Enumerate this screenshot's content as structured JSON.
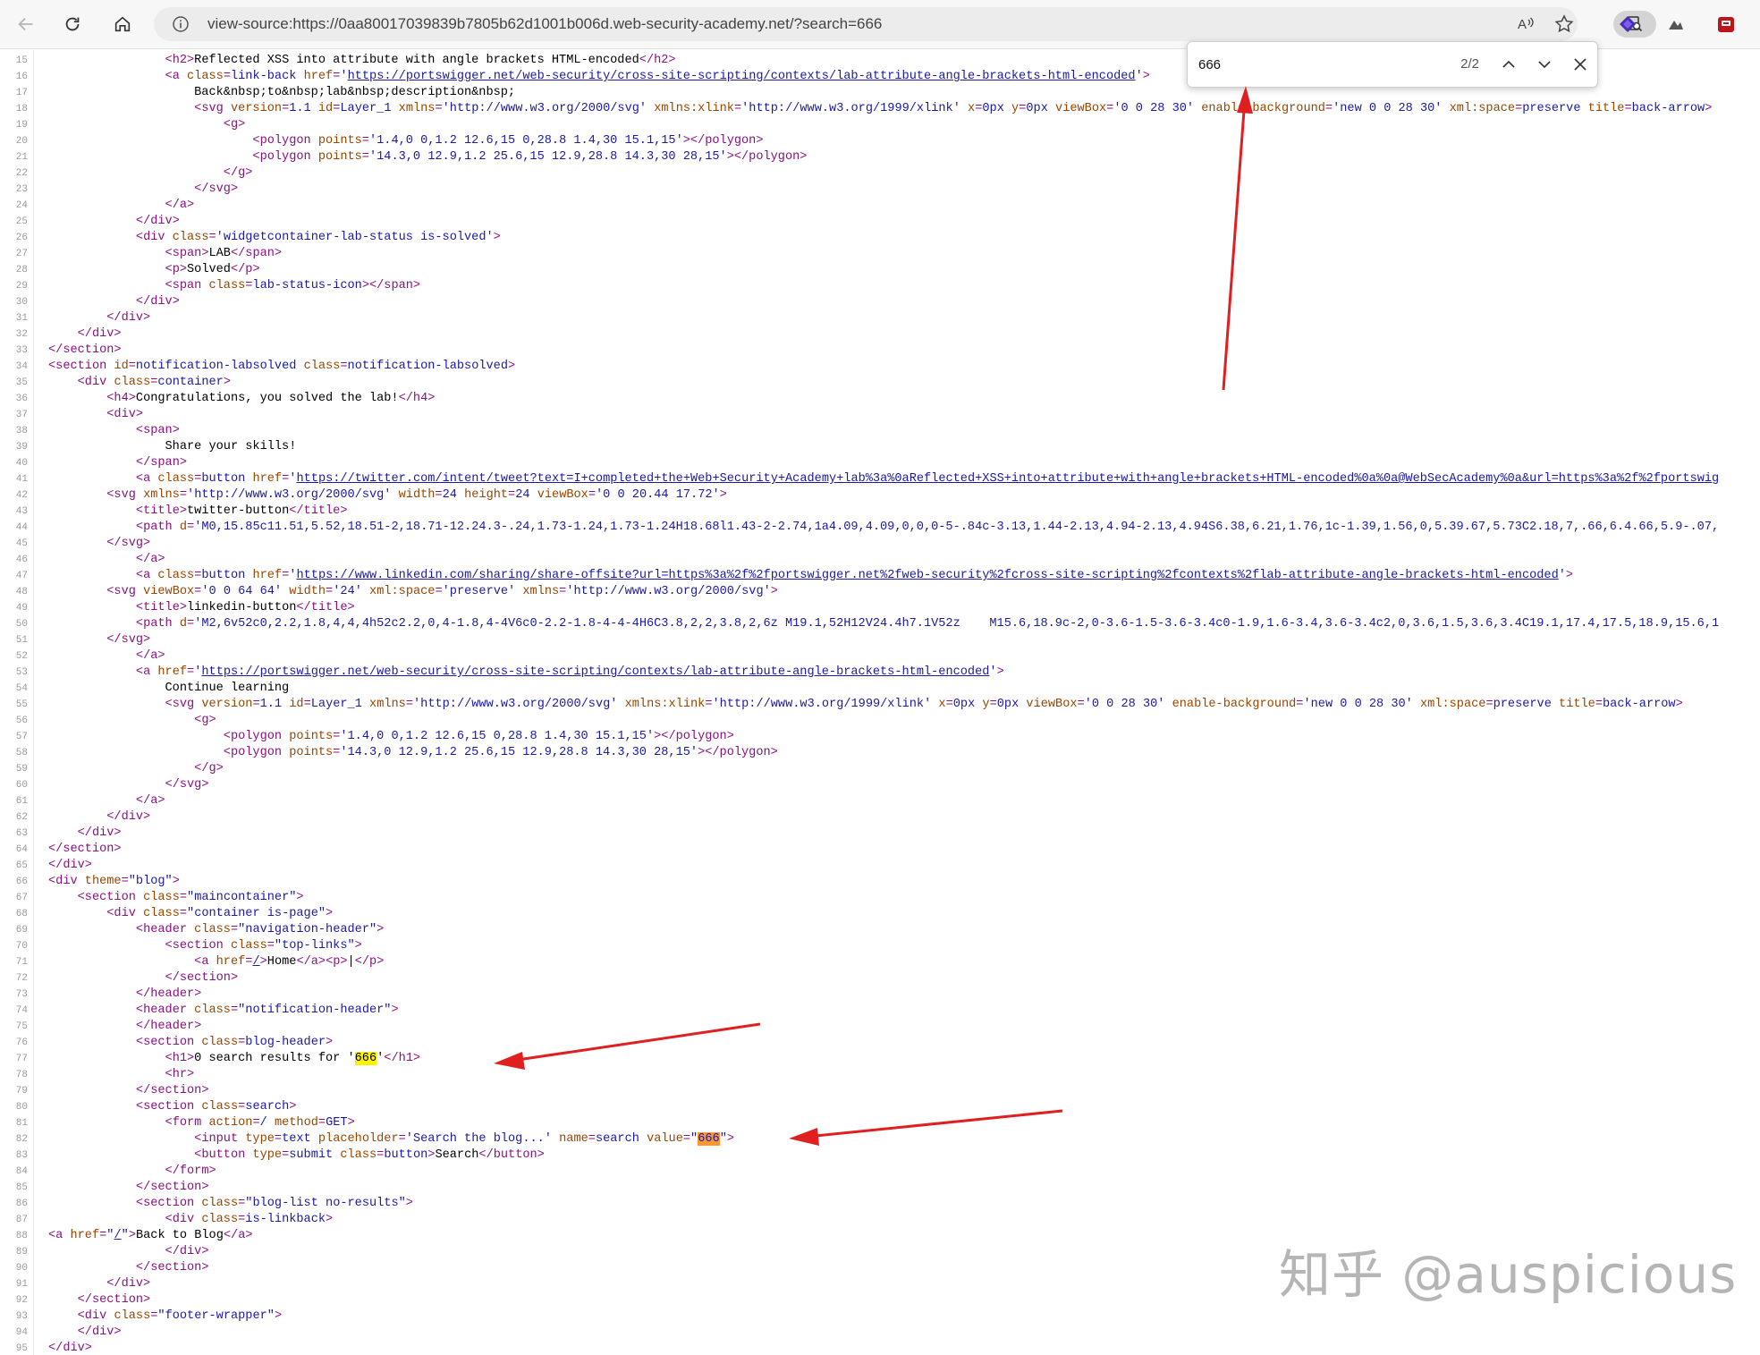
{
  "browser": {
    "url": "view-source:https://0aa80017039839b7805b62d1001b006d.web-security-academy.net/?search=666"
  },
  "find_bar": {
    "query": "666",
    "match_count": "2/2"
  },
  "source_lines": [
    {
      "n": "15",
      "html": "                <span class=\"t\">&lt;h2&gt;</span>Reflected XSS into attribute with angle brackets HTML-encoded<span class=\"t\">&lt;/h2&gt;</span>"
    },
    {
      "n": "16",
      "html": "                <span class=\"t\">&lt;a </span><span class=\"a\">class</span><span class=\"t\">=</span><span class=\"v\">link-back</span> <span class=\"a\">href</span><span class=\"t\">=</span><span class=\"v\">'</span><span class=\"l\">https://portswigger.net/web-security/cross-site-scripting/contexts/lab-attribute-angle-brackets-html-encoded</span><span class=\"v\">'</span><span class=\"t\">&gt;</span>"
    },
    {
      "n": "17",
      "html": "                    Back&amp;nbsp;to&amp;nbsp;lab&amp;nbsp;description&amp;nbsp;"
    },
    {
      "n": "18",
      "html": "                    <span class=\"t\">&lt;svg </span><span class=\"a\">version</span><span class=\"t\">=</span><span class=\"v\">1.1</span> <span class=\"a\">id</span><span class=\"t\">=</span><span class=\"v\">Layer_1</span> <span class=\"a\">xmlns</span><span class=\"t\">=</span><span class=\"v\">'http://www.w3.org/2000/svg'</span> <span class=\"a\">xmlns:xlink</span><span class=\"t\">=</span><span class=\"v\">'http://www.w3.org/1999/xlink'</span> <span class=\"a\">x</span><span class=\"t\">=</span><span class=\"v\">0px</span> <span class=\"a\">y</span><span class=\"t\">=</span><span class=\"v\">0px</span> <span class=\"a\">viewBox</span><span class=\"t\">=</span><span class=\"v\">'0 0 28 30'</span> <span class=\"a\">enable-background</span><span class=\"t\">=</span><span class=\"v\">'new 0 0 28 30'</span> <span class=\"a\">xml:space</span><span class=\"t\">=</span><span class=\"v\">preserve</span> <span class=\"a\">title</span><span class=\"t\">=</span><span class=\"v\">back-arrow</span><span class=\"t\">&gt;</span>"
    },
    {
      "n": "19",
      "html": "                        <span class=\"t\">&lt;g&gt;</span>"
    },
    {
      "n": "20",
      "html": "                            <span class=\"t\">&lt;polygon </span><span class=\"a\">points</span><span class=\"t\">=</span><span class=\"v\">'1.4,0 0,1.2 12.6,15 0,28.8 1.4,30 15.1,15'</span><span class=\"t\">&gt;&lt;/polygon&gt;</span>"
    },
    {
      "n": "21",
      "html": "                            <span class=\"t\">&lt;polygon </span><span class=\"a\">points</span><span class=\"t\">=</span><span class=\"v\">'14.3,0 12.9,1.2 25.6,15 12.9,28.8 14.3,30 28,15'</span><span class=\"t\">&gt;&lt;/polygon&gt;</span>"
    },
    {
      "n": "22",
      "html": "                        <span class=\"t\">&lt;/g&gt;</span>"
    },
    {
      "n": "23",
      "html": "                    <span class=\"t\">&lt;/svg&gt;</span>"
    },
    {
      "n": "24",
      "html": "                <span class=\"t\">&lt;/a&gt;</span>"
    },
    {
      "n": "25",
      "html": "            <span class=\"t\">&lt;/div&gt;</span>"
    },
    {
      "n": "26",
      "html": "            <span class=\"t\">&lt;div </span><span class=\"a\">class</span><span class=\"t\">=</span><span class=\"v\">'widgetcontainer-lab-status is-solved'</span><span class=\"t\">&gt;</span>"
    },
    {
      "n": "27",
      "html": "                <span class=\"t\">&lt;span&gt;</span>LAB<span class=\"t\">&lt;/span&gt;</span>"
    },
    {
      "n": "28",
      "html": "                <span class=\"t\">&lt;p&gt;</span>Solved<span class=\"t\">&lt;/p&gt;</span>"
    },
    {
      "n": "29",
      "html": "                <span class=\"t\">&lt;span </span><span class=\"a\">class</span><span class=\"t\">=</span><span class=\"v\">lab-status-icon</span><span class=\"t\">&gt;&lt;/span&gt;</span>"
    },
    {
      "n": "30",
      "html": "            <span class=\"t\">&lt;/div&gt;</span>"
    },
    {
      "n": "31",
      "html": "        <span class=\"t\">&lt;/div&gt;</span>"
    },
    {
      "n": "32",
      "html": "    <span class=\"t\">&lt;/div&gt;</span>"
    },
    {
      "n": "33",
      "html": "<span class=\"t\">&lt;/section&gt;</span>"
    },
    {
      "n": "34",
      "html": "<span class=\"t\">&lt;section </span><span class=\"a\">id</span><span class=\"t\">=</span><span class=\"v\">notification-labsolved</span> <span class=\"a\">class</span><span class=\"t\">=</span><span class=\"v\">notification-labsolved</span><span class=\"t\">&gt;</span>"
    },
    {
      "n": "35",
      "html": "    <span class=\"t\">&lt;div </span><span class=\"a\">class</span><span class=\"t\">=</span><span class=\"v\">container</span><span class=\"t\">&gt;</span>"
    },
    {
      "n": "36",
      "html": "        <span class=\"t\">&lt;h4&gt;</span>Congratulations, you solved the lab!<span class=\"t\">&lt;/h4&gt;</span>"
    },
    {
      "n": "37",
      "html": "        <span class=\"t\">&lt;div&gt;</span>"
    },
    {
      "n": "38",
      "html": "            <span class=\"t\">&lt;span&gt;</span>"
    },
    {
      "n": "39",
      "html": "                Share your skills!"
    },
    {
      "n": "40",
      "html": "            <span class=\"t\">&lt;/span&gt;</span>"
    },
    {
      "n": "41",
      "html": "            <span class=\"t\">&lt;a </span><span class=\"a\">class</span><span class=\"t\">=</span><span class=\"v\">button</span> <span class=\"a\">href</span><span class=\"t\">=</span><span class=\"v\">'</span><span class=\"l\">https://twitter.com/intent/tweet?text=I+completed+the+Web+Security+Academy+lab%3a%0aReflected+XSS+into+attribute+with+angle+brackets+HTML-encoded%0a%0a@WebSecAcademy%0a&amp;url=https%3a%2f%2fportswig</span>"
    },
    {
      "n": "42",
      "html": "        <span class=\"t\">&lt;svg </span><span class=\"a\">xmlns</span><span class=\"t\">=</span><span class=\"v\">'http://www.w3.org/2000/svg'</span> <span class=\"a\">width</span><span class=\"t\">=</span><span class=\"v\">24</span> <span class=\"a\">height</span><span class=\"t\">=</span><span class=\"v\">24</span> <span class=\"a\">viewBox</span><span class=\"t\">=</span><span class=\"v\">'0 0 20.44 17.72'</span><span class=\"t\">&gt;</span>"
    },
    {
      "n": "43",
      "html": "            <span class=\"t\">&lt;title&gt;</span>twitter-button<span class=\"t\">&lt;/title&gt;</span>"
    },
    {
      "n": "44",
      "html": "            <span class=\"t\">&lt;path </span><span class=\"a\">d</span><span class=\"t\">=</span><span class=\"v\">'M0,15.85c11.51,5.52,18.51-2,18.71-12.24.3-.24,1.73-1.24,1.73-1.24H18.68l1.43-2-2.74,1a4.09,4.09,0,0,0-5-.84c-3.13,1.44-2.13,4.94-2.13,4.94S6.38,6.21,1.76,1c-1.39,1.56,0,5.39.67,5.73C2.18,7,.66,6.4.66,5.9-.07,</span>"
    },
    {
      "n": "45",
      "html": "        <span class=\"t\">&lt;/svg&gt;</span>"
    },
    {
      "n": "46",
      "html": "            <span class=\"t\">&lt;/a&gt;</span>"
    },
    {
      "n": "47",
      "html": "            <span class=\"t\">&lt;a </span><span class=\"a\">class</span><span class=\"t\">=</span><span class=\"v\">button</span> <span class=\"a\">href</span><span class=\"t\">=</span><span class=\"v\">'</span><span class=\"l\">https://www.linkedin.com/sharing/share-offsite?url=https%3a%2f%2fportswigger.net%2fweb-security%2fcross-site-scripting%2fcontexts%2flab-attribute-angle-brackets-html-encoded</span><span class=\"v\">'</span><span class=\"t\">&gt;</span>"
    },
    {
      "n": "48",
      "html": "        <span class=\"t\">&lt;svg </span><span class=\"a\">viewBox</span><span class=\"t\">=</span><span class=\"v\">'0 0 64 64'</span> <span class=\"a\">width</span><span class=\"t\">=</span><span class=\"v\">'24'</span> <span class=\"a\">xml:space</span><span class=\"t\">=</span><span class=\"v\">'preserve'</span> <span class=\"a\">xmlns</span><span class=\"t\">=</span><span class=\"v\">'http://www.w3.org/2000/svg'</span><span class=\"t\">&gt;</span>"
    },
    {
      "n": "49",
      "html": "            <span class=\"t\">&lt;title&gt;</span>linkedin-button<span class=\"t\">&lt;/title&gt;</span>"
    },
    {
      "n": "50",
      "html": "            <span class=\"t\">&lt;path </span><span class=\"a\">d</span><span class=\"t\">=</span><span class=\"v\">'M2,6v52c0,2.2,1.8,4,4,4h52c2.2,0,4-1.8,4-4V6c0-2.2-1.8-4-4-4H6C3.8,2,2,3.8,2,6z M19.1,52H12V24.4h7.1V52z    M15.6,18.9c-2,0-3.6-1.5-3.6-3.4c0-1.9,1.6-3.4,3.6-3.4c2,0,3.6,1.5,3.6,3.4C19.1,17.4,17.5,18.9,15.6,1</span>"
    },
    {
      "n": "51",
      "html": "        <span class=\"t\">&lt;/svg&gt;</span>"
    },
    {
      "n": "52",
      "html": "            <span class=\"t\">&lt;/a&gt;</span>"
    },
    {
      "n": "53",
      "html": "            <span class=\"t\">&lt;a </span><span class=\"a\">href</span><span class=\"t\">=</span><span class=\"v\">'</span><span class=\"l\">https://portswigger.net/web-security/cross-site-scripting/contexts/lab-attribute-angle-brackets-html-encoded</span><span class=\"v\">'</span><span class=\"t\">&gt;</span>"
    },
    {
      "n": "54",
      "html": "                Continue learning"
    },
    {
      "n": "55",
      "html": "                <span class=\"t\">&lt;svg </span><span class=\"a\">version</span><span class=\"t\">=</span><span class=\"v\">1.1</span> <span class=\"a\">id</span><span class=\"t\">=</span><span class=\"v\">Layer_1</span> <span class=\"a\">xmlns</span><span class=\"t\">=</span><span class=\"v\">'http://www.w3.org/2000/svg'</span> <span class=\"a\">xmlns:xlink</span><span class=\"t\">=</span><span class=\"v\">'http://www.w3.org/1999/xlink'</span> <span class=\"a\">x</span><span class=\"t\">=</span><span class=\"v\">0px</span> <span class=\"a\">y</span><span class=\"t\">=</span><span class=\"v\">0px</span> <span class=\"a\">viewBox</span><span class=\"t\">=</span><span class=\"v\">'0 0 28 30'</span> <span class=\"a\">enable-background</span><span class=\"t\">=</span><span class=\"v\">'new 0 0 28 30'</span> <span class=\"a\">xml:space</span><span class=\"t\">=</span><span class=\"v\">preserve</span> <span class=\"a\">title</span><span class=\"t\">=</span><span class=\"v\">back-arrow</span><span class=\"t\">&gt;</span>"
    },
    {
      "n": "56",
      "html": "                    <span class=\"t\">&lt;g&gt;</span>"
    },
    {
      "n": "57",
      "html": "                        <span class=\"t\">&lt;polygon </span><span class=\"a\">points</span><span class=\"t\">=</span><span class=\"v\">'1.4,0 0,1.2 12.6,15 0,28.8 1.4,30 15.1,15'</span><span class=\"t\">&gt;&lt;/polygon&gt;</span>"
    },
    {
      "n": "58",
      "html": "                        <span class=\"t\">&lt;polygon </span><span class=\"a\">points</span><span class=\"t\">=</span><span class=\"v\">'14.3,0 12.9,1.2 25.6,15 12.9,28.8 14.3,30 28,15'</span><span class=\"t\">&gt;&lt;/polygon&gt;</span>"
    },
    {
      "n": "59",
      "html": "                    <span class=\"t\">&lt;/g&gt;</span>"
    },
    {
      "n": "60",
      "html": "                <span class=\"t\">&lt;/svg&gt;</span>"
    },
    {
      "n": "61",
      "html": "            <span class=\"t\">&lt;/a&gt;</span>"
    },
    {
      "n": "62",
      "html": "        <span class=\"t\">&lt;/div&gt;</span>"
    },
    {
      "n": "63",
      "html": "    <span class=\"t\">&lt;/div&gt;</span>"
    },
    {
      "n": "64",
      "html": "<span class=\"t\">&lt;/section&gt;</span>"
    },
    {
      "n": "65",
      "html": "<span class=\"t\">&lt;/div&gt;</span>"
    },
    {
      "n": "66",
      "html": "<span class=\"t\">&lt;div </span><span class=\"a\">theme</span><span class=\"t\">=</span><span class=\"v\">\"blog\"</span><span class=\"t\">&gt;</span>"
    },
    {
      "n": "67",
      "html": "    <span class=\"t\">&lt;section </span><span class=\"a\">class</span><span class=\"t\">=</span><span class=\"v\">\"maincontainer\"</span><span class=\"t\">&gt;</span>"
    },
    {
      "n": "68",
      "html": "        <span class=\"t\">&lt;div </span><span class=\"a\">class</span><span class=\"t\">=</span><span class=\"v\">\"container is-page\"</span><span class=\"t\">&gt;</span>"
    },
    {
      "n": "69",
      "html": "            <span class=\"t\">&lt;header </span><span class=\"a\">class</span><span class=\"t\">=</span><span class=\"v\">\"navigation-header\"</span><span class=\"t\">&gt;</span>"
    },
    {
      "n": "70",
      "html": "                <span class=\"t\">&lt;section </span><span class=\"a\">class</span><span class=\"t\">=</span><span class=\"v\">\"top-links\"</span><span class=\"t\">&gt;</span>"
    },
    {
      "n": "71",
      "html": "                    <span class=\"t\">&lt;a </span><span class=\"a\">href</span><span class=\"t\">=</span><span class=\"l\">/</span><span class=\"t\">&gt;</span>Home<span class=\"t\">&lt;/a&gt;&lt;p&gt;</span>|<span class=\"t\">&lt;/p&gt;</span>"
    },
    {
      "n": "72",
      "html": "                <span class=\"t\">&lt;/section&gt;</span>"
    },
    {
      "n": "73",
      "html": "            <span class=\"t\">&lt;/header&gt;</span>"
    },
    {
      "n": "74",
      "html": "            <span class=\"t\">&lt;header </span><span class=\"a\">class</span><span class=\"t\">=</span><span class=\"v\">\"notification-header\"</span><span class=\"t\">&gt;</span>"
    },
    {
      "n": "75",
      "html": "            <span class=\"t\">&lt;/header&gt;</span>"
    },
    {
      "n": "76",
      "html": "            <span class=\"t\">&lt;section </span><span class=\"a\">class</span><span class=\"t\">=</span><span class=\"v\">blog-header</span><span class=\"t\">&gt;</span>"
    },
    {
      "n": "77",
      "html": "                <span class=\"t\">&lt;h1&gt;</span>0 search results for '<span class=\"hl\">666</span>'<span class=\"t\">&lt;/h1&gt;</span>"
    },
    {
      "n": "78",
      "html": "                <span class=\"t\">&lt;hr&gt;</span>"
    },
    {
      "n": "79",
      "html": "            <span class=\"t\">&lt;/section&gt;</span>"
    },
    {
      "n": "80",
      "html": "            <span class=\"t\">&lt;section </span><span class=\"a\">class</span><span class=\"t\">=</span><span class=\"v\">search</span><span class=\"t\">&gt;</span>"
    },
    {
      "n": "81",
      "html": "                <span class=\"t\">&lt;form </span><span class=\"a\">action</span><span class=\"t\">=</span><span class=\"v\">/</span> <span class=\"a\">method</span><span class=\"t\">=</span><span class=\"v\">GET</span><span class=\"t\">&gt;</span>"
    },
    {
      "n": "82",
      "html": "                    <span class=\"t\">&lt;input </span><span class=\"a\">type</span><span class=\"t\">=</span><span class=\"v\">text</span> <span class=\"a\">placeholder</span><span class=\"t\">=</span><span class=\"v\">'Search the blog...'</span> <span class=\"a\">name</span><span class=\"t\">=</span><span class=\"v\">search</span> <span class=\"a\">value</span><span class=\"t\">=</span><span class=\"v\">\"<span class=\"hlc\">666</span>\"</span><span class=\"t\">&gt;</span>"
    },
    {
      "n": "83",
      "html": "                    <span class=\"t\">&lt;button </span><span class=\"a\">type</span><span class=\"t\">=</span><span class=\"v\">submit</span> <span class=\"a\">class</span><span class=\"t\">=</span><span class=\"v\">button</span><span class=\"t\">&gt;</span>Search<span class=\"t\">&lt;/button&gt;</span>"
    },
    {
      "n": "84",
      "html": "                <span class=\"t\">&lt;/form&gt;</span>"
    },
    {
      "n": "85",
      "html": "            <span class=\"t\">&lt;/section&gt;</span>"
    },
    {
      "n": "86",
      "html": "            <span class=\"t\">&lt;section </span><span class=\"a\">class</span><span class=\"t\">=</span><span class=\"v\">\"blog-list no-results\"</span><span class=\"t\">&gt;</span>"
    },
    {
      "n": "87",
      "html": "                <span class=\"t\">&lt;div </span><span class=\"a\">class</span><span class=\"t\">=</span><span class=\"v\">is-linkback</span><span class=\"t\">&gt;</span>"
    },
    {
      "n": "88",
      "html": "<span class=\"t\">&lt;a </span><span class=\"a\">href</span><span class=\"t\">=</span><span class=\"v\">\"<span class=\"l\">/</span>\"</span><span class=\"t\">&gt;</span>Back to Blog<span class=\"t\">&lt;/a&gt;</span>"
    },
    {
      "n": "89",
      "html": "                <span class=\"t\">&lt;/div&gt;</span>"
    },
    {
      "n": "90",
      "html": "            <span class=\"t\">&lt;/section&gt;</span>"
    },
    {
      "n": "91",
      "html": "        <span class=\"t\">&lt;/div&gt;</span>"
    },
    {
      "n": "92",
      "html": "    <span class=\"t\">&lt;/section&gt;</span>"
    },
    {
      "n": "93",
      "html": "    <span class=\"t\">&lt;div </span><span class=\"a\">class</span><span class=\"t\">=</span><span class=\"v\">\"footer-wrapper\"</span><span class=\"t\">&gt;</span>"
    },
    {
      "n": "94",
      "html": "    <span class=\"t\">&lt;/div&gt;</span>"
    },
    {
      "n": "95",
      "html": "<span class=\"t\">&lt;/div&gt;</span>"
    }
  ],
  "watermark": "知乎 @auspicious",
  "colors": {
    "arrow": "#e02020",
    "highlight": "#fff200",
    "highlight_current": "#ff9632"
  }
}
